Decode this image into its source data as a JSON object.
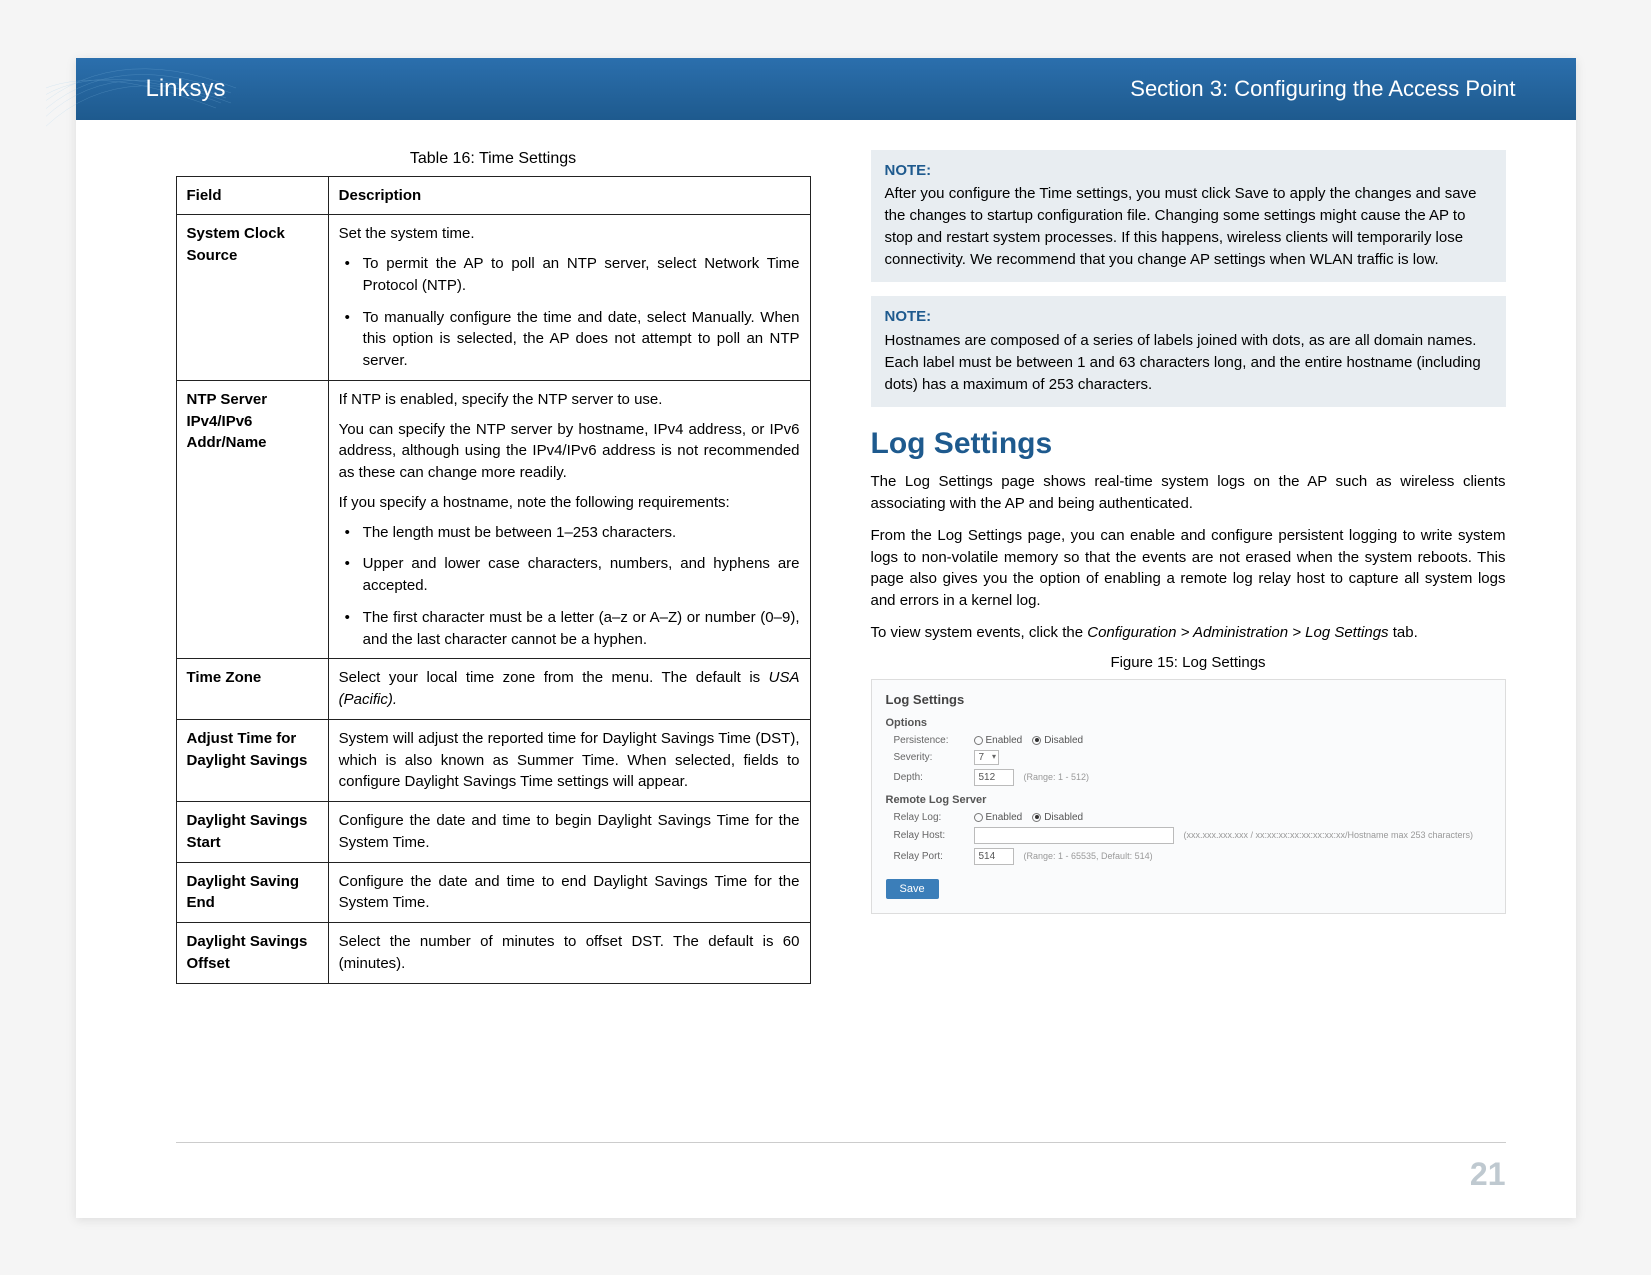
{
  "header": {
    "brand": "Linksys",
    "section": "Section 3:  Configuring the Access Point"
  },
  "left": {
    "table_caption": "Table 16: Time Settings",
    "th_field": "Field",
    "th_desc": "Description",
    "rows": {
      "r0": {
        "field": "System Clock Source",
        "p0": "Set the system time.",
        "b0": "To permit the AP to poll an NTP server, select Network Time Protocol (NTP).",
        "b1": "To manually configure the time and date, select Manually. When this option is selected, the AP does not attempt to poll an NTP server."
      },
      "r1": {
        "field": "NTP Server IPv4/IPv6 Addr/Name",
        "p0": "If NTP is enabled, specify the NTP server to use.",
        "p1": "You can specify the NTP server by hostname, IPv4 address, or IPv6 address, although using the IPv4/IPv6 address is not recommended as these can change more readily.",
        "p2": "If you specify a hostname, note the following requirements:",
        "b0": "The length must be between 1–253 characters.",
        "b1": "Upper and lower case characters, numbers, and hyphens are accepted.",
        "b2": "The first character must be a letter (a–z or A–Z) or number (0–9), and the last character cannot be a hyphen."
      },
      "r2": {
        "field": "Time Zone",
        "p0a": "Select your local time zone from the menu. The default is ",
        "p0b": "USA (Pacific)."
      },
      "r3": {
        "field": "Adjust Time for Daylight Savings",
        "p0": "System will adjust the reported time for Daylight Savings Time (DST), which is also known as Summer Time. When selected, fields to configure Daylight Savings Time settings will appear."
      },
      "r4": {
        "field": "Daylight Savings Start",
        "p0": "Configure the date and time to begin Daylight Savings Time for the System Time."
      },
      "r5": {
        "field": "Daylight Saving End",
        "p0": "Configure the date and time to end Daylight Savings Time for the System Time."
      },
      "r6": {
        "field": "Daylight Savings Offset",
        "p0": "Select the number of minutes to offset DST. The default is 60 (minutes)."
      }
    }
  },
  "right": {
    "note1_label": "NOTE:",
    "note1_body": "After you configure the Time settings, you must click Save to apply the changes and save the changes to startup configuration file. Changing some settings might cause the AP to stop and restart system processes. If this happens, wireless clients will temporarily lose connectivity. We recommend that you change AP settings when WLAN traffic is low.",
    "note2_label": "NOTE:",
    "note2_body": "Hostnames are composed of a series of labels joined with dots, as are all domain names. Each label must be between 1 and 63 characters long, and the entire hostname (including dots) has a maximum of 253 characters.",
    "heading": "Log Settings",
    "p0": "The Log Settings page shows real-time system logs on the AP such as wireless clients associating with the AP and being authenticated.",
    "p1": "From the Log Settings page, you can enable and configure persistent logging to write system logs to non-volatile memory so that the events are not erased when the system reboots. This page also gives you the option of enabling a remote log relay host to capture all system logs and errors in a kernel log.",
    "p2a": "To view system events, click the ",
    "p2b": "Configuration > Administration > Log Settings",
    "p2c": " tab.",
    "fig_caption": "Figure 15: Log Settings",
    "screenshot": {
      "title": "Log Settings",
      "sec_options": "Options",
      "lbl_persistence": "Persistence:",
      "opt_enabled": "Enabled",
      "opt_disabled": "Disabled",
      "lbl_severity": "Severity:",
      "val_severity": "7",
      "lbl_depth": "Depth:",
      "val_depth": "512",
      "hint_depth": "(Range: 1 - 512)",
      "sec_remote": "Remote Log Server",
      "lbl_relay_log": "Relay Log:",
      "lbl_relay_host": "Relay Host:",
      "hint_relay_host": "(xxx.xxx.xxx.xxx / xx:xx:xx:xx:xx:xx:xx:xx/Hostname max 253 characters)",
      "lbl_relay_port": "Relay Port:",
      "val_relay_port": "514",
      "hint_relay_port": "(Range: 1 - 65535, Default: 514)",
      "btn_save": "Save"
    }
  },
  "page_number": "21"
}
